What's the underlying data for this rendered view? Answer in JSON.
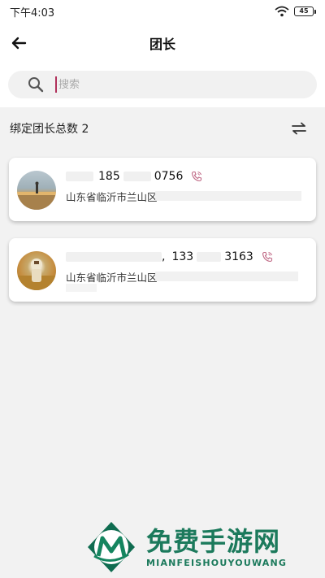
{
  "status_bar": {
    "time": "下午4:03",
    "battery": "45"
  },
  "nav": {
    "title": "团长"
  },
  "search": {
    "placeholder": "搜索"
  },
  "summary": {
    "bound_count_label": "绑定团长总数 2"
  },
  "leaders": [
    {
      "phone_prefix": "185",
      "phone_suffix": "0756",
      "address": "山东省临沂市兰山区"
    },
    {
      "separator": ",",
      "phone_prefix": "133",
      "phone_suffix": "3163",
      "address": "山东省临沂市兰山区"
    }
  ],
  "watermark": {
    "title": "免费手游网",
    "subtitle": "MIANFEISHOUYOUWANG"
  },
  "colors": {
    "accent": "#b0305a",
    "watermark": "#1c7a5c",
    "phone_icon": "#c06a86"
  }
}
